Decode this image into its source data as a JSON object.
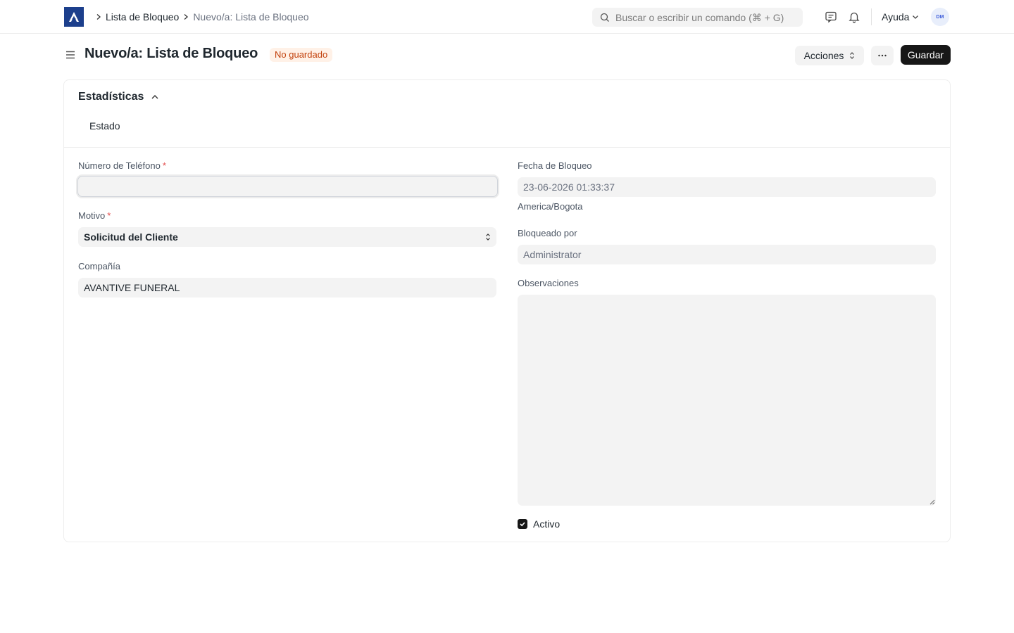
{
  "navbar": {
    "breadcrumbs": [
      "Lista de Bloqueo",
      "Nuevo/a: Lista de Bloqueo"
    ],
    "search_placeholder": "Buscar o escribir un comando (⌘ + G)",
    "help_label": "Ayuda",
    "avatar_initials": "DM",
    "icons": [
      "logo-icon",
      "chevron-right-icon",
      "search-icon",
      "chat-icon",
      "bell-icon",
      "chevron-down-icon"
    ]
  },
  "page": {
    "title": "Nuevo/a: Lista de Bloqueo",
    "status_badge": "No guardado",
    "actions_label": "Acciones",
    "more_label": "···",
    "save_label": "Guardar"
  },
  "section": {
    "title": "Estadísticas",
    "estado_label": "Estado"
  },
  "form": {
    "left": {
      "phone_label": "Número de Teléfono",
      "phone_value": "",
      "reason_label": "Motivo",
      "reason_value": "Solicitud del Cliente",
      "company_label": "Compañía",
      "company_value": "AVANTIVE FUNERAL"
    },
    "right": {
      "block_date_label": "Fecha de Bloqueo",
      "block_date_value": "23-06-2026 01:33:37",
      "timezone": "America/Bogota",
      "blocked_by_label": "Bloqueado por",
      "blocked_by_value": "Administrator",
      "notes_label": "Observaciones",
      "notes_value": "",
      "active_label": "Activo",
      "active_checked": true
    },
    "required_marker": "*"
  },
  "colors": {
    "brand": "#1c3f8c",
    "badge_bg": "#fff1e7",
    "badge_text": "#c2410c",
    "primary_button": "#171717",
    "input_bg": "#f3f3f3"
  }
}
